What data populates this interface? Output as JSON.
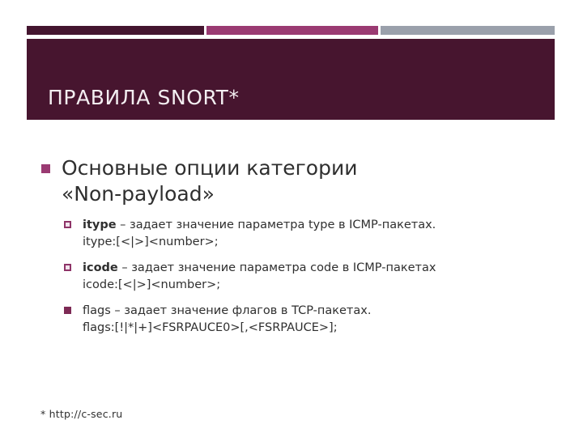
{
  "slide": {
    "title": "ПРАВИЛА SNORT*",
    "footnote": "* http://c-sec.ru"
  },
  "accent_bar": {
    "segments": [
      {
        "name": "dark",
        "color": "#44152f"
      },
      {
        "name": "plum",
        "color": "#9a3a72"
      },
      {
        "name": "grey",
        "color": "#9aa0ab"
      }
    ]
  },
  "colors": {
    "title_band": "#47152f",
    "title_text": "#f3eef1",
    "bullet_level1": "#9a3a72",
    "bullet_level2_outline": "#8e3468",
    "bullet_level2_solid": "#7d2a55",
    "body_text": "#2f2f2f",
    "background": "#ffffff"
  },
  "content": {
    "bullets": [
      {
        "marker": "square-solid-plum",
        "text": "Основные опции категории",
        "text_second_line": "«Non-payload»",
        "items": [
          {
            "marker": "square-hollow",
            "term": "itype",
            "description": " – задает значение параметра type в ICMP-пакетах.",
            "syntax": "itype:[<|>]<number>;"
          },
          {
            "marker": "square-hollow",
            "term": "icode",
            "description": " – задает значение параметра code в ICMP-пакетах",
            "syntax": "icode:[<|>]<number>;"
          },
          {
            "marker": "square-solid",
            "term": "flags",
            "description": " – задает значение флагов в TCP-пакетах.",
            "syntax": "flags:[!|*|+]<FSRPAUCE0>[,<FSRPAUCE>];"
          }
        ]
      }
    ]
  }
}
